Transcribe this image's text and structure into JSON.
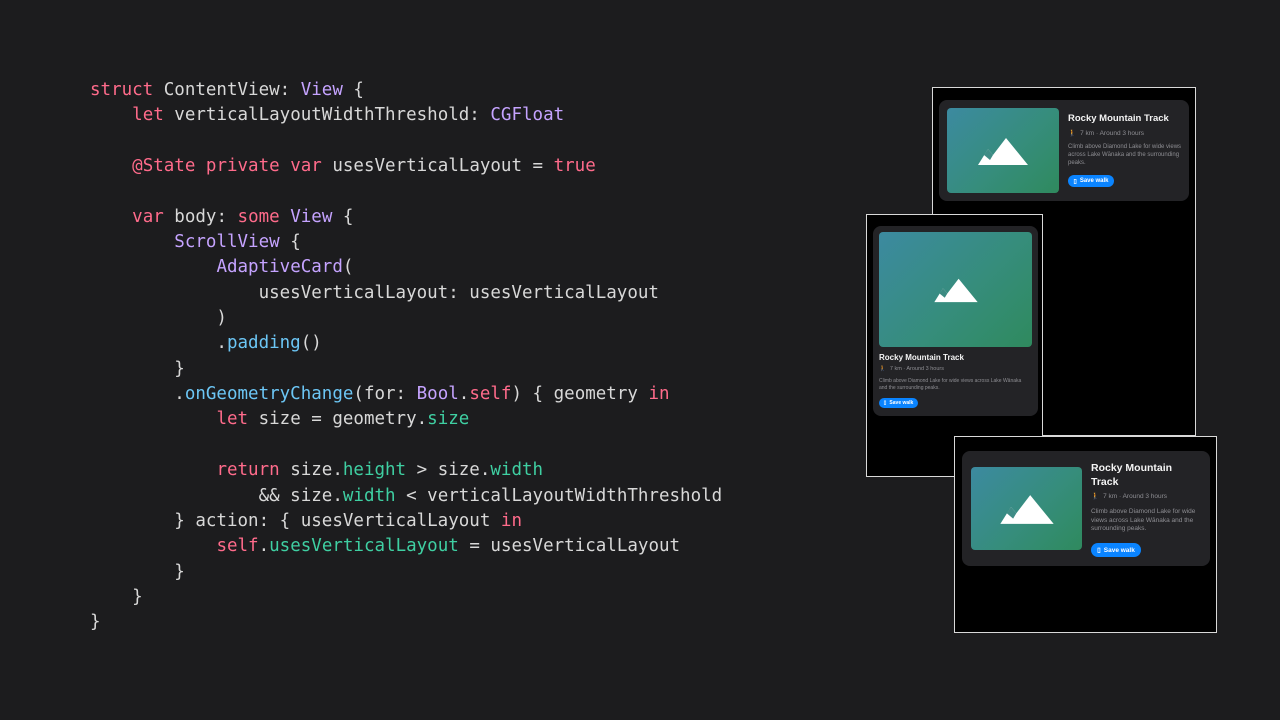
{
  "colors": {
    "background": "#1c1c1e",
    "keyword": "#ff6b8b",
    "type": "#c5a3ff",
    "function": "#6cc6f5",
    "property": "#3fcfa2",
    "text": "#d8d8d8",
    "accent": "#0a84ff"
  },
  "code": {
    "lines": [
      [
        [
          "kw",
          "struct"
        ],
        [
          "tx",
          " ContentView: "
        ],
        [
          "ty",
          "View"
        ],
        [
          "tx",
          " {"
        ]
      ],
      [
        [
          "tx",
          "    "
        ],
        [
          "kw",
          "let"
        ],
        [
          "tx",
          " verticalLayoutWidthThreshold: "
        ],
        [
          "ty",
          "CGFloat"
        ]
      ],
      [],
      [
        [
          "tx",
          "    "
        ],
        [
          "kw",
          "@State private var"
        ],
        [
          "tx",
          " usesVerticalLayout = "
        ],
        [
          "kw",
          "true"
        ]
      ],
      [],
      [
        [
          "tx",
          "    "
        ],
        [
          "kw",
          "var"
        ],
        [
          "tx",
          " body: "
        ],
        [
          "kw",
          "some"
        ],
        [
          "tx",
          " "
        ],
        [
          "ty",
          "View"
        ],
        [
          "tx",
          " {"
        ]
      ],
      [
        [
          "tx",
          "        "
        ],
        [
          "ty",
          "ScrollView"
        ],
        [
          "tx",
          " {"
        ]
      ],
      [
        [
          "tx",
          "            "
        ],
        [
          "ty",
          "AdaptiveCard"
        ],
        [
          "tx",
          "("
        ]
      ],
      [
        [
          "tx",
          "                usesVerticalLayout: usesVerticalLayout"
        ]
      ],
      [
        [
          "tx",
          "            )"
        ]
      ],
      [
        [
          "tx",
          "            ."
        ],
        [
          "fn",
          "padding"
        ],
        [
          "tx",
          "()"
        ]
      ],
      [
        [
          "tx",
          "        }"
        ]
      ],
      [
        [
          "tx",
          "        ."
        ],
        [
          "fn",
          "onGeometryChange"
        ],
        [
          "tx",
          "(for: "
        ],
        [
          "ty",
          "Bool"
        ],
        [
          "tx",
          "."
        ],
        [
          "kw",
          "self"
        ],
        [
          "tx",
          ") { geometry "
        ],
        [
          "kw",
          "in"
        ]
      ],
      [
        [
          "tx",
          "            "
        ],
        [
          "kw",
          "let"
        ],
        [
          "tx",
          " size = geometry."
        ],
        [
          "pr",
          "size"
        ]
      ],
      [],
      [
        [
          "tx",
          "            "
        ],
        [
          "kw",
          "return"
        ],
        [
          "tx",
          " size."
        ],
        [
          "pr",
          "height"
        ],
        [
          "tx",
          " > size."
        ],
        [
          "pr",
          "width"
        ]
      ],
      [
        [
          "tx",
          "                && size."
        ],
        [
          "pr",
          "width"
        ],
        [
          "tx",
          " < verticalLayoutWidthThreshold"
        ]
      ],
      [
        [
          "tx",
          "        } action: { usesVerticalLayout "
        ],
        [
          "kw",
          "in"
        ]
      ],
      [
        [
          "tx",
          "            "
        ],
        [
          "kw",
          "self"
        ],
        [
          "tx",
          "."
        ],
        [
          "pr",
          "usesVerticalLayout"
        ],
        [
          "tx",
          " = usesVerticalLayout"
        ]
      ],
      [
        [
          "tx",
          "        }"
        ]
      ],
      [
        [
          "tx",
          "    }"
        ]
      ],
      [
        [
          "tx",
          "}"
        ]
      ]
    ]
  },
  "previews": [
    {
      "title": "Rocky Mountain Track",
      "meta": "7 km · Around 3 hours",
      "description": "Climb above Diamond Lake for wide views across Lake Wānaka and the surrounding peaks.",
      "button": "Save walk",
      "layout": "horizontal"
    },
    {
      "title": "Rocky Mountain Track",
      "meta": "7 km · Around 3 hours",
      "description": "Climb above Diamond Lake for wide views across Lake Wānaka and the surrounding peaks.",
      "button": "Save walk",
      "layout": "vertical"
    },
    {
      "title": "Rocky Mountain Track",
      "meta": "7 km · Around 3 hours",
      "description": "Climb above Diamond Lake for wide views across Lake Wānaka and the surrounding peaks.",
      "button": "Save walk",
      "layout": "horizontal"
    }
  ],
  "icons": {
    "image": "mountain-icon",
    "meta": "hiking-figure-icon",
    "button": "bookmark-icon"
  }
}
